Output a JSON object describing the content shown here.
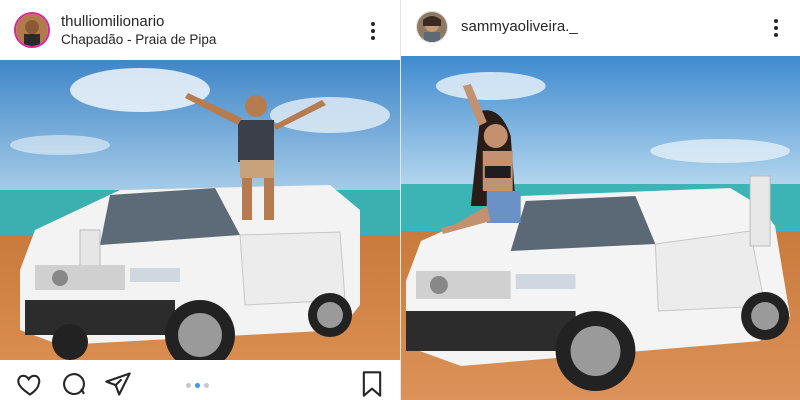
{
  "left_post": {
    "username": "thulliomilionario",
    "location": "Chapadão - Praia de Pipa",
    "avatar": "profile-avatar",
    "more_icon": "more-vertical-icon",
    "actions": [
      "heart-icon",
      "comment-icon",
      "share-icon",
      "bookmark-icon"
    ],
    "carousel": {
      "count": 3,
      "active": 2
    }
  },
  "right_post": {
    "username": "sammyaoliveira._",
    "avatar": "profile-avatar",
    "more_icon": "more-vertical-icon"
  },
  "colors": {
    "accent": "#3897f0",
    "text": "#262626"
  }
}
